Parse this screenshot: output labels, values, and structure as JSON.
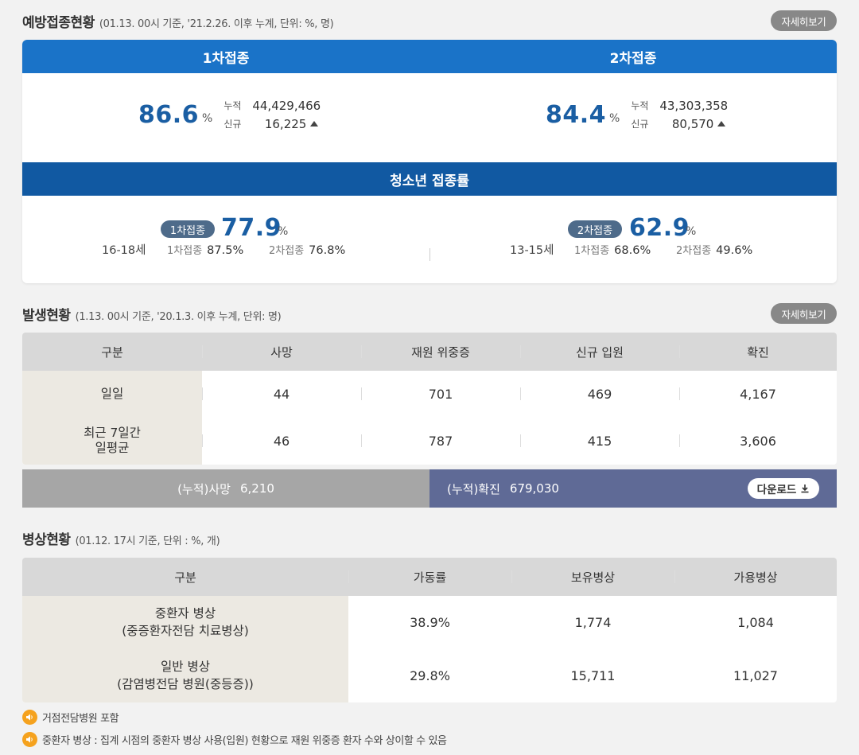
{
  "vaccination": {
    "title": "예방접종현황",
    "subtitle": "(01.13. 00시 기준, '21.2.26. 이후 누계, 단위: %, 명)",
    "more_label": "자세히보기",
    "dose1": {
      "tab": "1차접종",
      "rate": "86.6",
      "unit": "%",
      "cum_label": "누적",
      "cum_value": "44,429,466",
      "new_label": "신규",
      "new_value": "16,225"
    },
    "dose2": {
      "tab": "2차접종",
      "rate": "84.4",
      "unit": "%",
      "cum_label": "누적",
      "cum_value": "43,303,358",
      "new_label": "신규",
      "new_value": "80,570"
    },
    "youth": {
      "title": "청소년 접종률",
      "group_a": {
        "age": "16-18세",
        "chip": "1차접종",
        "rate": "77.9",
        "unit": "%",
        "d1_label": "1차접종",
        "d1_value": "87.5%",
        "d2_label": "2차접종",
        "d2_value": "76.8%"
      },
      "group_b": {
        "age": "13-15세",
        "chip": "2차접종",
        "rate": "62.9",
        "unit": "%",
        "d1_label": "1차접종",
        "d1_value": "68.6%",
        "d2_label": "2차접종",
        "d2_value": "49.6%"
      }
    }
  },
  "occurrence": {
    "title": "발생현황",
    "subtitle": "(1.13. 00시 기준, '20.1.3. 이후 누계, 단위: 명)",
    "more_label": "자세히보기",
    "headers": [
      "구분",
      "사망",
      "재원 위중증",
      "신규 입원",
      "확진"
    ],
    "rows": [
      {
        "label": "일일",
        "values": [
          "44",
          "701",
          "469",
          "4,167"
        ]
      },
      {
        "label": "최근 7일간\n일평균",
        "values": [
          "46",
          "787",
          "415",
          "3,606"
        ]
      }
    ],
    "cum_death_label": "(누적)사망",
    "cum_death_value": "6,210",
    "cum_confirmed_label": "(누적)확진",
    "cum_confirmed_value": "679,030",
    "download_label": "다운로드"
  },
  "beds": {
    "title": "병상현황",
    "subtitle": "(01.12. 17시 기준, 단위 : %, 개)",
    "headers": [
      "구분",
      "가동률",
      "보유병상",
      "가용병상"
    ],
    "rows": [
      {
        "label": "중환자 병상\n(중증환자전담 치료병상)",
        "values": [
          "38.9%",
          "1,774",
          "1,084"
        ]
      },
      {
        "label": "일반 병상\n(감염병전담 병원(중등증))",
        "values": [
          "29.8%",
          "15,711",
          "11,027"
        ]
      }
    ],
    "notes": [
      "거점전담병원 포함",
      "중환자 병상 : 집계 시점의 중환자 병상 사용(입원) 현황으로 재원 위중증 환자 수와 상이할 수 있음"
    ]
  },
  "colors": {
    "tab_blue": "#1a73c8",
    "youth_blue": "#1159a2",
    "rate_blue": "#1a5ea3",
    "cum_gray": "#a6a6a6",
    "cum_purple": "#5f6a96",
    "note_orange": "#f5a21e"
  },
  "icons": [
    "triangle-up-icon",
    "download-icon",
    "speaker-icon"
  ]
}
